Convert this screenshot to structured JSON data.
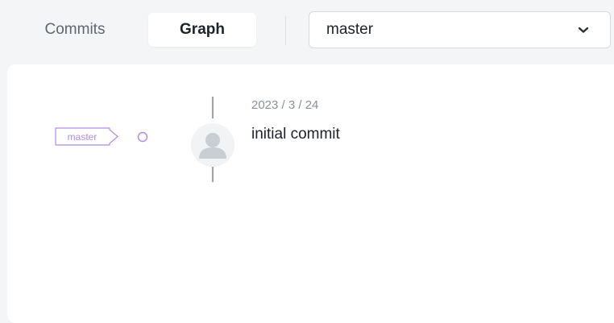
{
  "tabs": {
    "commits_label": "Commits",
    "graph_label": "Graph",
    "active": "Graph"
  },
  "branch_selector": {
    "value": "master",
    "icon": "chevron-down-icon"
  },
  "graph": {
    "branch_tag": "master",
    "node_icon": "commit-node-icon",
    "tag_color": "#b18ce5"
  },
  "commits": [
    {
      "date": "2023 / 3 / 24",
      "message": "initial commit",
      "avatar_icon": "user-avatar-icon"
    }
  ]
}
